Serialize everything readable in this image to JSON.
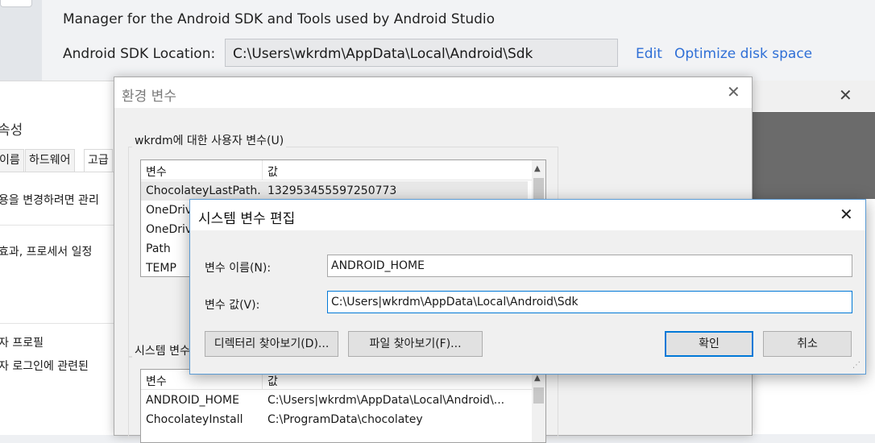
{
  "android_studio": {
    "description": "Manager for the Android SDK and Tools used by Android Studio",
    "sdk_location_label": "Android SDK Location:",
    "sdk_location_value": "C:\\Users\\wkrdm\\AppData\\Local\\Android\\Sdk",
    "edit_link": "Edit",
    "optimize_link": "Optimize disk space"
  },
  "system_properties": {
    "title": "속성",
    "tabs": [
      "이름",
      "하드웨어",
      "고급"
    ],
    "line1": "용을 변경하려면 관리",
    "line2": "효과, 프로세서 일정",
    "section_user_profile": "자 프로필",
    "line3": "자 로그인에 관련된"
  },
  "env_dialog": {
    "title": "환경 변수",
    "user_group_label": "wkrdm에 대한 사용자 변수(U)",
    "system_group_label": "시스템 변수",
    "col_variable": "변수",
    "col_value": "값",
    "user_vars": [
      {
        "name": "ChocolateyLastPath...",
        "value": "132953455597250773"
      },
      {
        "name": "OneDrive",
        "value": ""
      },
      {
        "name": "OneDrive",
        "value": ""
      },
      {
        "name": "Path",
        "value": ""
      },
      {
        "name": "TEMP",
        "value": ""
      }
    ],
    "system_vars": [
      {
        "name": "ANDROID_HOME",
        "value": "C:\\Users|wkrdm\\AppData\\Local\\Android\\..."
      },
      {
        "name": "ChocolateyInstall",
        "value": "C:\\ProgramData\\chocolatey"
      }
    ]
  },
  "edit_dialog": {
    "title": "시스템 변수 편집",
    "name_label": "변수 이름(N):",
    "name_value": "ANDROID_HOME",
    "value_label": "변수 값(V):",
    "value_value": "C:\\Users|wkrdm\\AppData\\Local\\Android\\Sdk",
    "browse_dir_button": "디렉터리 찾아보기(D)...",
    "browse_file_button": "파일 찾아보기(F)...",
    "ok_button": "확인",
    "cancel_button": "취소"
  }
}
